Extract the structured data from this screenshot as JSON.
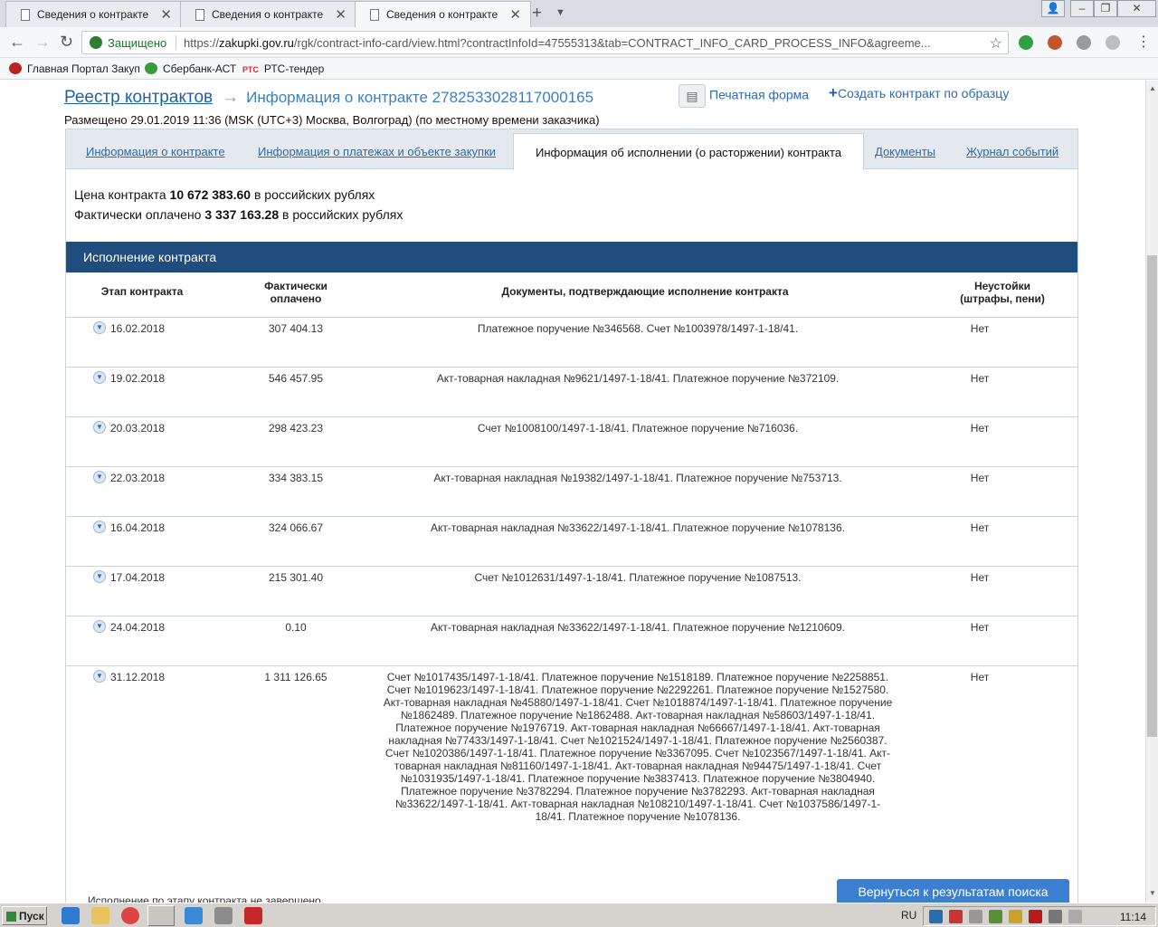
{
  "browser": {
    "tabs": [
      {
        "title": "Сведения о контракте",
        "active": false
      },
      {
        "title": "Сведения о контракте",
        "active": false
      },
      {
        "title": "Сведения о контракте",
        "active": true
      }
    ],
    "secure_label": "Защищено",
    "url_prefix": "https://",
    "url_domain": "zakupki.gov.ru",
    "url_path": "/rgk/contract-info-card/view.html?contractInfoId=47555313&tab=CONTRACT_INFO_CARD_PROCESS_INFO&agreeme...",
    "bookmarks": [
      "Главная Портал Закуп",
      "Сбербанк-АСТ",
      "РТС-тендер"
    ],
    "bookmark_colors": [
      "#b22",
      "#3a9a3a",
      "#c33"
    ],
    "rts_badge": "РТС"
  },
  "page": {
    "registry_link": "Реестр контрактов",
    "breadcrumb_current": "Информация о контракте 2782533028117000165",
    "print_label": "Печатная форма",
    "create_label": "Создать контракт по образцу",
    "posted": "Размещено 29.01.2019 11:36 (MSK (UTC+3) Москва, Волгоград) (по местному времени заказчика)",
    "tabs": [
      "Информация о контракте",
      "Информация о платежах и объекте закупки",
      "Информация об исполнении (о расторжении) контракта",
      "Документы",
      "Журнал событий"
    ],
    "price_prefix": "Цена контракта ",
    "price_value": "10 672 383.60",
    "price_suffix": " в российских рублях",
    "paid_prefix": "Фактически оплачено ",
    "paid_value": "3 337 163.28",
    "paid_suffix": " в российских рублях",
    "exec_header": "Исполнение контракта",
    "columns": {
      "stage": "Этап контракта",
      "paid": "Фактически оплачено",
      "docs": "Документы, подтверждающие исполнение контракта",
      "penalties": "Неустойки (штрафы, пени)"
    },
    "rows": [
      {
        "date": "16.02.2018",
        "amount": "307 404.13",
        "docs": "Платежное поручение №346568. Счет №1003978/1497-1-18/41.",
        "penalty": "Нет"
      },
      {
        "date": "19.02.2018",
        "amount": "546 457.95",
        "docs": "Акт-товарная накладная №9621/1497-1-18/41. Платежное поручение №372109.",
        "penalty": "Нет"
      },
      {
        "date": "20.03.2018",
        "amount": "298 423.23",
        "docs": "Счет №1008100/1497-1-18/41. Платежное поручение №716036.",
        "penalty": "Нет"
      },
      {
        "date": "22.03.2018",
        "amount": "334 383.15",
        "docs": "Акт-товарная накладная №19382/1497-1-18/41. Платежное поручение №753713.",
        "penalty": "Нет"
      },
      {
        "date": "16.04.2018",
        "amount": "324 066.67",
        "docs": "Акт-товарная накладная №33622/1497-1-18/41. Платежное поручение №1078136.",
        "penalty": "Нет"
      },
      {
        "date": "17.04.2018",
        "amount": "215 301.40",
        "docs": "Счет №1012631/1497-1-18/41. Платежное поручение №1087513.",
        "penalty": "Нет"
      },
      {
        "date": "24.04.2018",
        "amount": "0.10",
        "docs": "Акт-товарная накладная №33622/1497-1-18/41. Платежное поручение №1210609.",
        "penalty": "Нет"
      },
      {
        "date": "31.12.2018",
        "amount": "1 311 126.65",
        "docs": "Счет №1017435/1497-1-18/41. Платежное поручение №1518189. Платежное поручение №2258851. Счет №1019623/1497-1-18/41. Платежное поручение №2292261. Платежное поручение №1527580. Акт-товарная накладная №45880/1497-1-18/41. Счет №1018874/1497-1-18/41. Платежное поручение №1862489. Платежное поручение №1862488. Акт-товарная накладная №58603/1497-1-18/41. Платежное поручение №1976719. Акт-товарная накладная №66667/1497-1-18/41. Акт-товарная накладная №77433/1497-1-18/41. Счет №1021524/1497-1-18/41. Платежное поручение №2560387. Счет №1020386/1497-1-18/41. Платежное поручение №3367095. Счет №1023567/1497-1-18/41. Акт-товарная накладная №81160/1497-1-18/41. Акт-товарная накладная №94475/1497-1-18/41. Счет №1031935/1497-1-18/41. Платежное поручение №3837413. Платежное поручение №3804940. Платежное поручение №3782294. Платежное поручение №3782293. Акт-товарная накладная №33622/1497-1-18/41. Акт-товарная накладная №108210/1497-1-18/41. Счет №1037586/1497-1-18/41. Платежное поручение №1078136.",
        "penalty": "Нет"
      }
    ],
    "not_done": "Исполнение по этапу контракта не завершено",
    "back_button": "Вернуться к результатам поиска"
  },
  "taskbar": {
    "start_label": "Пуск",
    "lang": "RU",
    "time": "11:14"
  }
}
